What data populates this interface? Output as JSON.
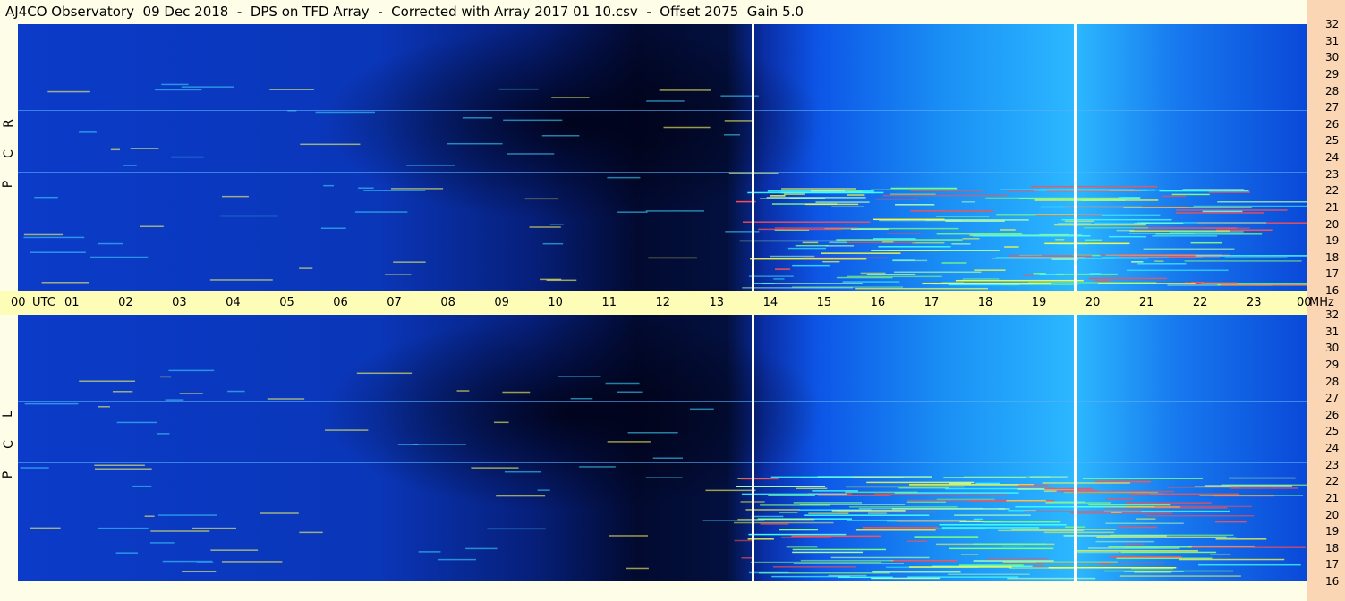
{
  "title": "AJ4CO Observatory  09 Dec 2018  -  DPS on TFD Array  -  Corrected with Array 2017 01 10.csv  -  Offset 2075  Gain 5.0",
  "colors": {
    "background": "#0a3fd0",
    "dark": "#000000",
    "bright": "#3fc8ff",
    "hot": "#ffff40",
    "band": "#fdfdb8",
    "strip": "#fbd6b4"
  },
  "chart_data": [
    {
      "type": "heatmap",
      "polarization": "R C P",
      "x_ticks": [
        "00",
        "UTC",
        "01",
        "02",
        "03",
        "04",
        "05",
        "06",
        "07",
        "08",
        "09",
        "10",
        "11",
        "12",
        "13",
        "14",
        "15",
        "16",
        "17",
        "18",
        "19",
        "20",
        "21",
        "22",
        "23",
        "00"
      ],
      "x_unit": "MHz",
      "y_ticks": [
        "32",
        "31",
        "30",
        "29",
        "28",
        "27",
        "26",
        "25",
        "24",
        "23",
        "22",
        "21",
        "20",
        "19",
        "18",
        "17",
        "16"
      ],
      "ylim": [
        16,
        32
      ],
      "xlim": [
        0,
        24
      ]
    },
    {
      "type": "heatmap",
      "polarization": "L C P",
      "x_ticks": [
        "00",
        "UTC",
        "01",
        "02",
        "03",
        "04",
        "05",
        "06",
        "07",
        "08",
        "09",
        "10",
        "11",
        "12",
        "13",
        "14",
        "15",
        "16",
        "17",
        "18",
        "19",
        "20",
        "21",
        "22",
        "23",
        "00"
      ],
      "x_unit": "MHz",
      "y_ticks": [
        "32",
        "31",
        "30",
        "29",
        "28",
        "27",
        "26",
        "25",
        "24",
        "23",
        "22",
        "21",
        "20",
        "19",
        "18",
        "17",
        "16"
      ],
      "ylim": [
        16,
        32
      ],
      "xlim": [
        0,
        24
      ]
    }
  ]
}
